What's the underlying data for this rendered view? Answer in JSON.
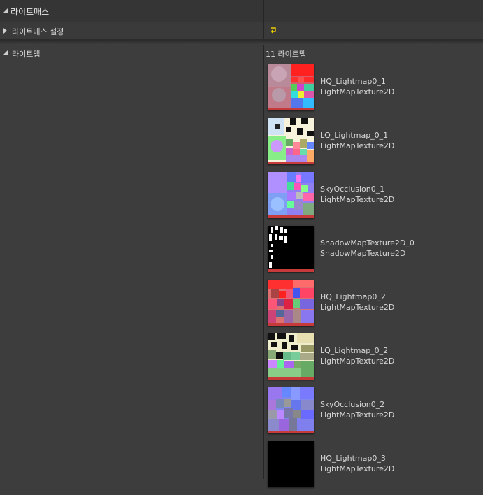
{
  "section": {
    "title": "라이트매스"
  },
  "settings_row": {
    "label": "라이트매스 설정"
  },
  "lightmaps": {
    "label": "라이트맵",
    "count_text": "11 라이트맵",
    "items": [
      {
        "name": "HQ_Lightmap0_1",
        "type": "LightMapTexture2D"
      },
      {
        "name": "LQ_Lightmap_0_1",
        "type": "LightMapTexture2D"
      },
      {
        "name": "SkyOcclusion0_1",
        "type": "LightMapTexture2D"
      },
      {
        "name": "ShadowMapTexture2D_0",
        "type": "ShadowMapTexture2D"
      },
      {
        "name": "HQ_Lightmap0_2",
        "type": "LightMapTexture2D"
      },
      {
        "name": "LQ_Lightmap_0_2",
        "type": "LightMapTexture2D"
      },
      {
        "name": "SkyOcclusion0_2",
        "type": "LightMapTexture2D"
      },
      {
        "name": "HQ_Lightmap0_3",
        "type": "LightMapTexture2D"
      }
    ]
  },
  "icons": {
    "reset": "reset-to-default-icon"
  },
  "colors": {
    "accent_bar": "#c73a3a",
    "reset_icon": "#f0d000"
  }
}
